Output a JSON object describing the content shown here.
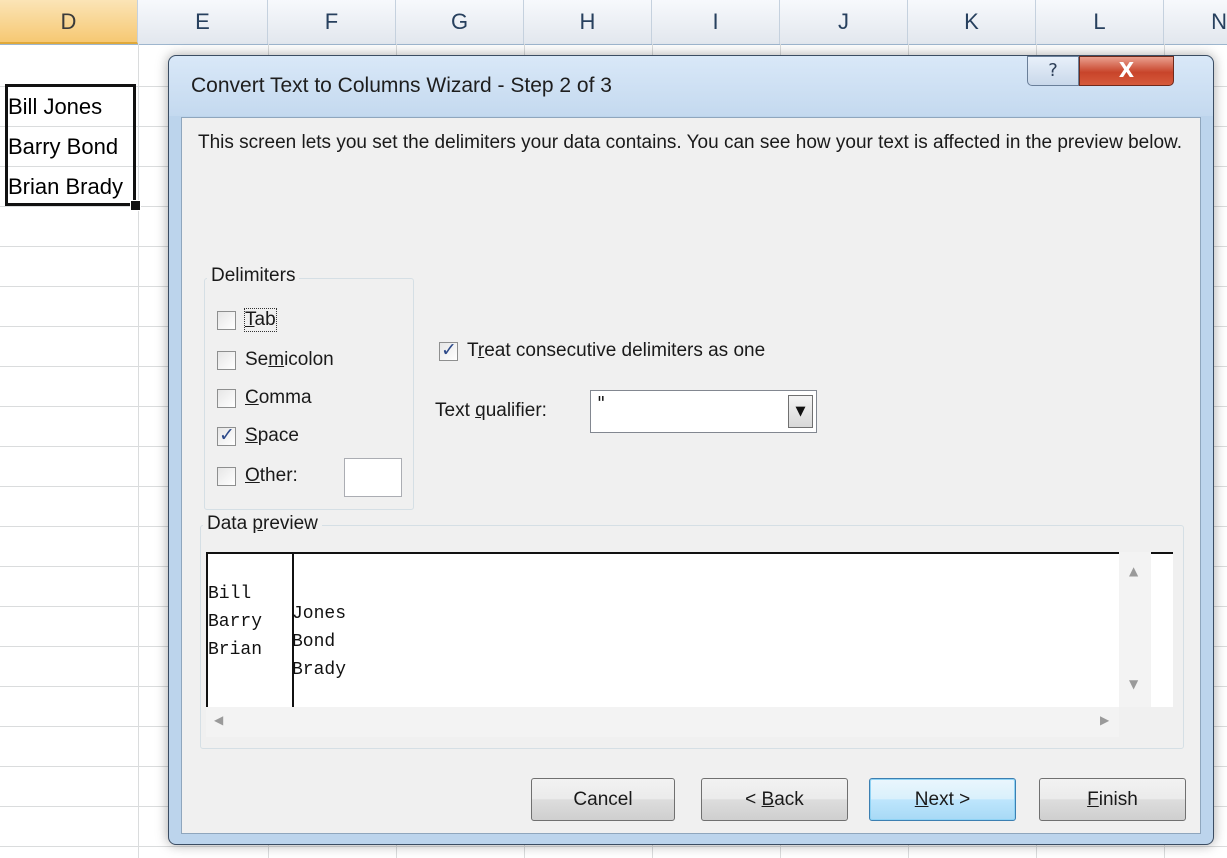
{
  "sheet": {
    "columns": [
      "D",
      "E",
      "F",
      "G",
      "H",
      "I",
      "J",
      "K",
      "L",
      "N"
    ],
    "selected_column": "D",
    "cells": [
      "Bill Jones",
      "Barry Bond",
      "Brian Brady"
    ]
  },
  "dialog": {
    "title": "Convert Text to Columns Wizard - Step 2 of 3",
    "help_label": "?",
    "close_label": "X",
    "description": "This screen lets you set the delimiters your data contains.  You can see how your text is affected in the preview below.",
    "delimiters": {
      "group_label": "Delimiters",
      "tab": {
        "label": "Tab",
        "checked": false
      },
      "semicolon": {
        "label": "Semicolon",
        "checked": false
      },
      "comma": {
        "label": "Comma",
        "checked": false
      },
      "space": {
        "label": "Space",
        "checked": true
      },
      "other": {
        "label": "Other:",
        "checked": false,
        "value": ""
      }
    },
    "treat_consecutive": {
      "label": "Treat consecutive delimiters as one",
      "checked": true
    },
    "text_qualifier": {
      "label": "Text qualifier:",
      "value": "\""
    },
    "preview": {
      "group_label": "Data preview",
      "rows": [
        [
          "Bill",
          "Jones"
        ],
        [
          "Barry",
          "Bond"
        ],
        [
          "Brian",
          "Brady"
        ]
      ]
    },
    "buttons": {
      "cancel": "Cancel",
      "back": "< Back",
      "next": "Next >",
      "finish": "Finish"
    }
  },
  "colors": {
    "selected_column_header": "#f6c873",
    "dialog_frame": "#bcd4ec",
    "close_button": "#c8442a"
  }
}
